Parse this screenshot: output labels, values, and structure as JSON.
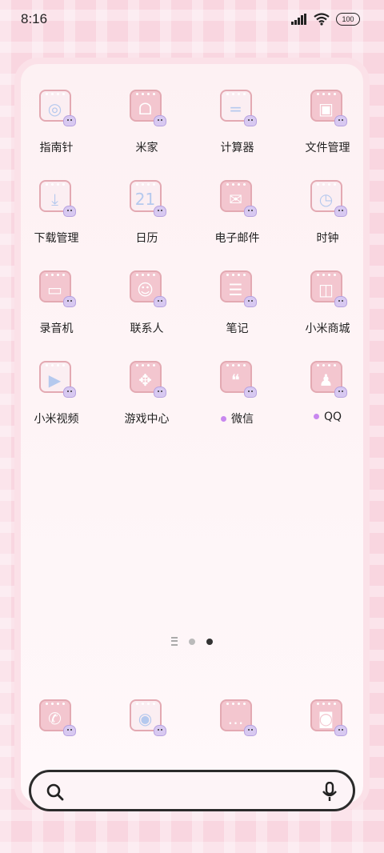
{
  "status_bar": {
    "time": "8:16",
    "battery": "100"
  },
  "apps": [
    {
      "label": "指南针",
      "icon": "compass-icon",
      "glyph": "◎",
      "style": "light"
    },
    {
      "label": "米家",
      "icon": "mijia-icon",
      "glyph": "ᗝ",
      "style": "pink"
    },
    {
      "label": "计算器",
      "icon": "calculator-icon",
      "glyph": "=",
      "style": "light"
    },
    {
      "label": "文件管理",
      "icon": "folder-icon",
      "glyph": "▣",
      "style": "pink"
    },
    {
      "label": "下载管理",
      "icon": "download-icon",
      "glyph": "⤓",
      "style": "light"
    },
    {
      "label": "日历",
      "icon": "calendar-icon",
      "glyph": "21",
      "style": "light"
    },
    {
      "label": "电子邮件",
      "icon": "mail-icon",
      "glyph": "✉",
      "style": "pink"
    },
    {
      "label": "时钟",
      "icon": "clock-icon",
      "glyph": "◷",
      "style": "light"
    },
    {
      "label": "录音机",
      "icon": "recorder-icon",
      "glyph": "▭",
      "style": "pink"
    },
    {
      "label": "联系人",
      "icon": "contacts-icon",
      "glyph": "☺",
      "style": "pink"
    },
    {
      "label": "笔记",
      "icon": "notes-icon",
      "glyph": "☰",
      "style": "pink"
    },
    {
      "label": "小米商城",
      "icon": "shop-bag-icon",
      "glyph": "◫",
      "style": "pink"
    },
    {
      "label": "小米视频",
      "icon": "video-play-icon",
      "glyph": "▶",
      "style": "light"
    },
    {
      "label": "游戏中心",
      "icon": "game-center-icon",
      "glyph": "✥",
      "style": "pink"
    },
    {
      "label": "微信",
      "icon": "wechat-icon",
      "glyph": "❝",
      "style": "pink",
      "new": true
    },
    {
      "label": "QQ",
      "icon": "qq-penguin-icon",
      "glyph": "♟",
      "style": "pink",
      "new": true
    }
  ],
  "dock": [
    {
      "icon": "phone-icon",
      "glyph": "✆",
      "style": "pink"
    },
    {
      "icon": "browser-icon",
      "glyph": "◉",
      "style": "light"
    },
    {
      "icon": "messages-icon",
      "glyph": "…",
      "style": "pink"
    },
    {
      "icon": "camera-icon",
      "glyph": "◙",
      "style": "pink"
    }
  ],
  "page_indicator": {
    "pages": 2,
    "active": 2
  },
  "colors": {
    "wallpaper": "#f9d6e0",
    "tile": "#f3c6cf",
    "accent_dot": "#c887ef"
  }
}
